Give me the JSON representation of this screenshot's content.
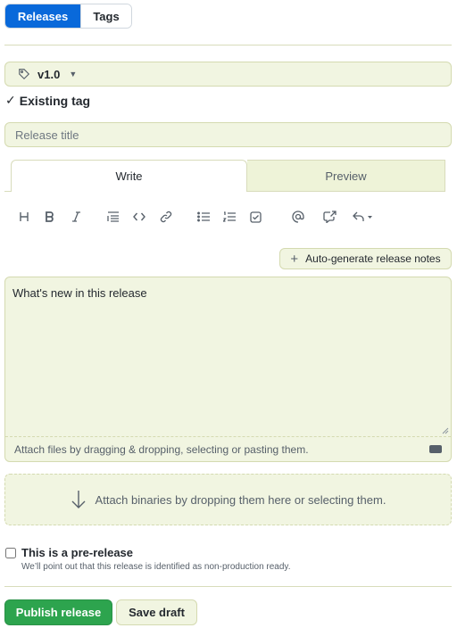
{
  "tabs": {
    "releases": "Releases",
    "tags": "Tags"
  },
  "tag_select": {
    "value": "v1.0",
    "icon": "tag-icon"
  },
  "tag_status": "Existing tag",
  "release_title": {
    "placeholder": "Release title",
    "value": ""
  },
  "editor_tabs": {
    "write": "Write",
    "preview": "Preview"
  },
  "toolbar": [
    "heading-icon",
    "bold-icon",
    "italic-icon",
    "quote-icon",
    "code-icon",
    "link-icon",
    "unordered-list-icon",
    "ordered-list-icon",
    "task-list-icon",
    "mention-icon",
    "cross-reference-icon",
    "reply-icon"
  ],
  "auto_generate": "Auto-generate release notes",
  "description": {
    "placeholder": "What's new in this release",
    "value": ""
  },
  "attach_files": "Attach files by dragging & dropping, selecting or pasting them.",
  "attach_binaries": "Attach binaries by dropping them here or selecting them.",
  "prerelease": {
    "label": "This is a pre-release",
    "hint": "We’ll point out that this release is identified as non-production ready.",
    "checked": false
  },
  "buttons": {
    "publish": "Publish release",
    "draft": "Save draft"
  },
  "colors": {
    "primary": "#0969da",
    "publish": "#2da44e",
    "field_bg": "#f1f5e1"
  }
}
